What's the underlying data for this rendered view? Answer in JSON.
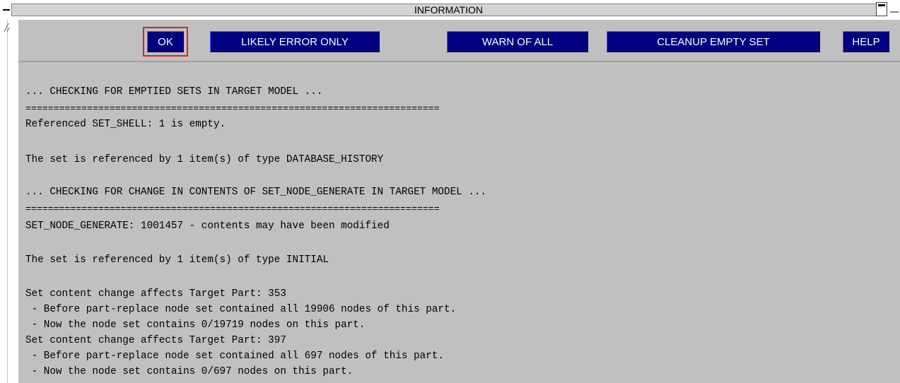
{
  "window": {
    "title": "INFORMATION"
  },
  "toolbar": {
    "ok_label": "OK",
    "likely_error_label": "LIKELY ERROR ONLY",
    "warn_all_label": "WARN OF ALL",
    "cleanup_label": "CLEANUP EMPTY SET",
    "help_label": "HELP"
  },
  "log": {
    "lines": [
      "... CHECKING FOR EMPTIED SETS IN TARGET MODEL ...",
      "==========================================================================",
      "Referenced SET_SHELL: 1 is empty.",
      "",
      "The set is referenced by 1 item(s) of type DATABASE_HISTORY",
      "",
      "... CHECKING FOR CHANGE IN CONTENTS OF SET_NODE_GENERATE IN TARGET MODEL ...",
      "==========================================================================",
      "SET_NODE_GENERATE: 1001457 - contents may have been modified",
      "",
      "The set is referenced by 1 item(s) of type INITIAL",
      "",
      "Set content change affects Target Part: 353",
      " - Before part-replace node set contained all 19906 nodes of this part.",
      " - Now the node set contains 0/19719 nodes on this part.",
      "Set content change affects Target Part: 397",
      " - Before part-replace node set contained all 697 nodes of this part.",
      " - Now the node set contains 0/697 nodes on this part."
    ]
  },
  "colors": {
    "button_bg": "#000080",
    "button_text": "#ffffff",
    "panel_bg": "#c0c0c0",
    "focus_border": "#e02020"
  },
  "icons": {
    "title_left": "minus-icon",
    "title_right": "minimize-icon"
  }
}
